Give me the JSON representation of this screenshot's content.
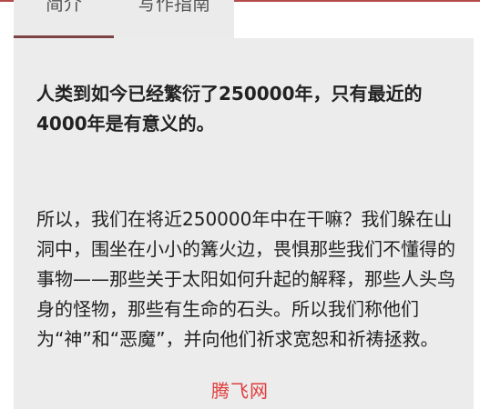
{
  "tabs": [
    {
      "label": "简介",
      "active": true
    },
    {
      "label": "写作指南",
      "active": false
    }
  ],
  "content": {
    "lead": "人类到如今已经繁衍了250000年，只有最近的4000年是有意义的。",
    "body": "所以，我们在将近250000年中在干嘛？我们躲在山洞中，围坐在小小的篝火边，畏惧那些我们不懂得的事物——那些关于太阳如何升起的解释，那些人头鸟身的怪物，那些有生命的石头。所以我们称他们为“神”和“恶魔”，并向他们祈求宽恕和祈祷拯救。"
  },
  "watermark": "腾飞网",
  "colors": {
    "accent": "#b24a4a",
    "tab_indicator": "#7a4242",
    "panel_bg": "#ececec",
    "watermark": "#e03c3c"
  }
}
